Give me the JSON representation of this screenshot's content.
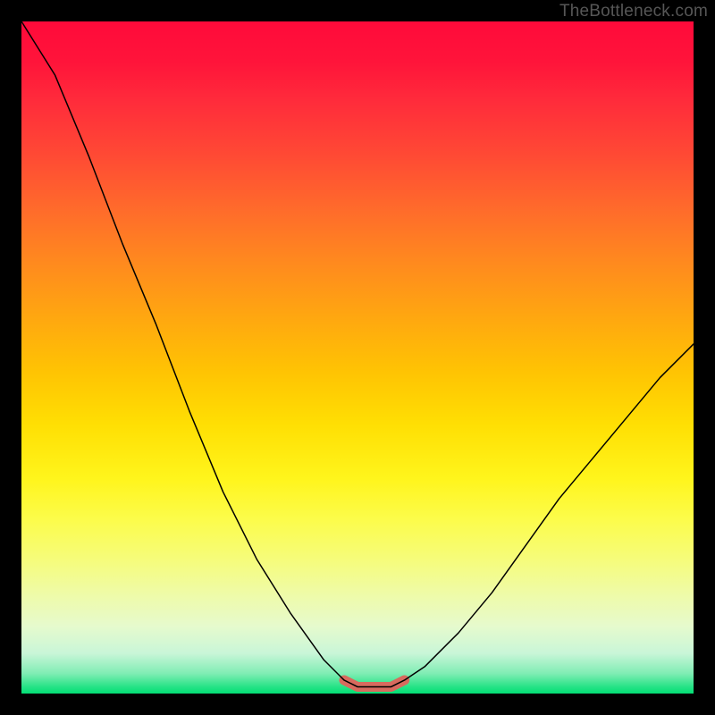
{
  "watermark": "TheBottleneck.com",
  "chart_data": {
    "type": "line",
    "title": "",
    "xlabel": "",
    "ylabel": "",
    "xlim": [
      0,
      100
    ],
    "ylim": [
      0,
      100
    ],
    "grid": false,
    "series": [
      {
        "name": "bottleneck-curve",
        "x": [
          0,
          5,
          10,
          15,
          20,
          25,
          30,
          35,
          40,
          45,
          48,
          50,
          52,
          55,
          57,
          60,
          65,
          70,
          75,
          80,
          85,
          90,
          95,
          100
        ],
        "values": [
          100,
          92,
          80,
          67,
          55,
          42,
          30,
          20,
          12,
          5,
          2,
          1,
          1,
          1,
          2,
          4,
          9,
          15,
          22,
          29,
          35,
          41,
          47,
          52
        ]
      },
      {
        "name": "recommended-range",
        "x": [
          48,
          50,
          52,
          55,
          57
        ],
        "values": [
          2,
          1,
          1,
          1,
          2
        ]
      }
    ],
    "colors": {
      "curve": "#000000",
      "recommended": "#d86a5e",
      "gradient_top": "#ff0a3a",
      "gradient_mid": "#ffe000",
      "gradient_bottom": "#03de75"
    },
    "stroke_width": {
      "curve": 1.5,
      "recommended": 11
    }
  }
}
